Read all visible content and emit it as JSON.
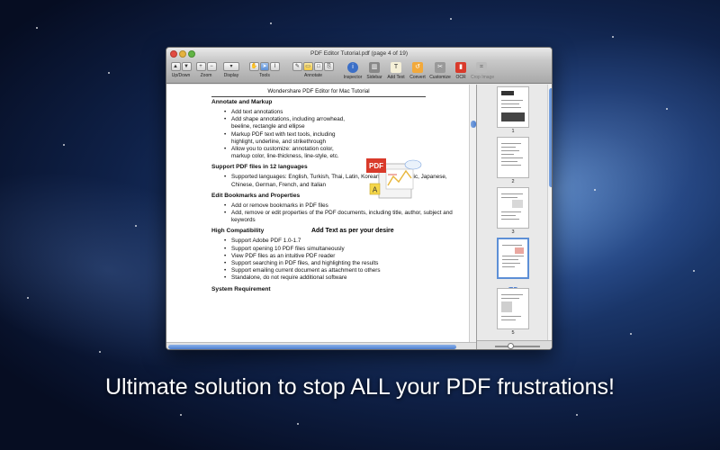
{
  "window": {
    "title": "PDF Editor Tutorial.pdf (page 4 of 19)"
  },
  "toolbar": {
    "groups": [
      {
        "label": "Up/Down"
      },
      {
        "label": "Zoom"
      },
      {
        "label": "Display"
      },
      {
        "label": "Tools"
      },
      {
        "label": "Annotate"
      },
      {
        "label": "Inspector"
      },
      {
        "label": "Sidebar"
      },
      {
        "label": "Add Text"
      },
      {
        "label": "Convert"
      },
      {
        "label": "Customize"
      },
      {
        "label": "OCR"
      },
      {
        "label": "Crop Image"
      }
    ]
  },
  "document": {
    "header": "Wondershare PDF Editor for Mac Tutorial",
    "sections": [
      {
        "heading": "Annotate and Markup",
        "items": [
          "Add text annotations",
          "Add shape annotations, including arrowhead, beeline, rectangle and ellipse",
          "Markup PDF text with text tools, including highlight, underline, and strikethrough",
          "Allow you to customize: annotation color, markup color, line-thickness, line-style, etc."
        ]
      },
      {
        "heading": "Support PDF files in 12 languages",
        "items": [
          "Supported languages: English, Turkish, Thai, Latin, Korean, Greek, Cyrillic, Japanese, Chinese, German, French, and Italian"
        ]
      },
      {
        "heading": "Edit Bookmarks and Properties",
        "items": [
          "Add or remove bookmarks in PDF files",
          "Add, remove or edit properties of the PDF documents, including title, author, subject and keywords"
        ]
      },
      {
        "heading": "High Compatibility",
        "items": [
          "Support Adobe PDF 1.0-1.7",
          "Support opening 10 PDF files simultaneously",
          "View PDF files as an intuitive PDF reader",
          "Support searching in PDF files, and highlighting the results",
          "Support emailing current document as attachment to others",
          "Standalone, do not require additional software"
        ]
      },
      {
        "heading": "System Requirement",
        "items": []
      }
    ],
    "callout": "Add Text as per your desire",
    "art_label_pdf": "PDF",
    "art_label_a": "A"
  },
  "sidebar": {
    "thumbnails": [
      {
        "num": "1",
        "selected": false
      },
      {
        "num": "2",
        "selected": false
      },
      {
        "num": "3",
        "selected": false
      },
      {
        "num": "4",
        "selected": true
      },
      {
        "num": "5",
        "selected": false
      }
    ]
  },
  "tagline": "Ultimate solution to stop ALL your PDF frustrations!",
  "colors": {
    "accent": "#4d7fcf",
    "pdf_red": "#d93a2b",
    "highlight_yellow": "#f4d64a"
  }
}
